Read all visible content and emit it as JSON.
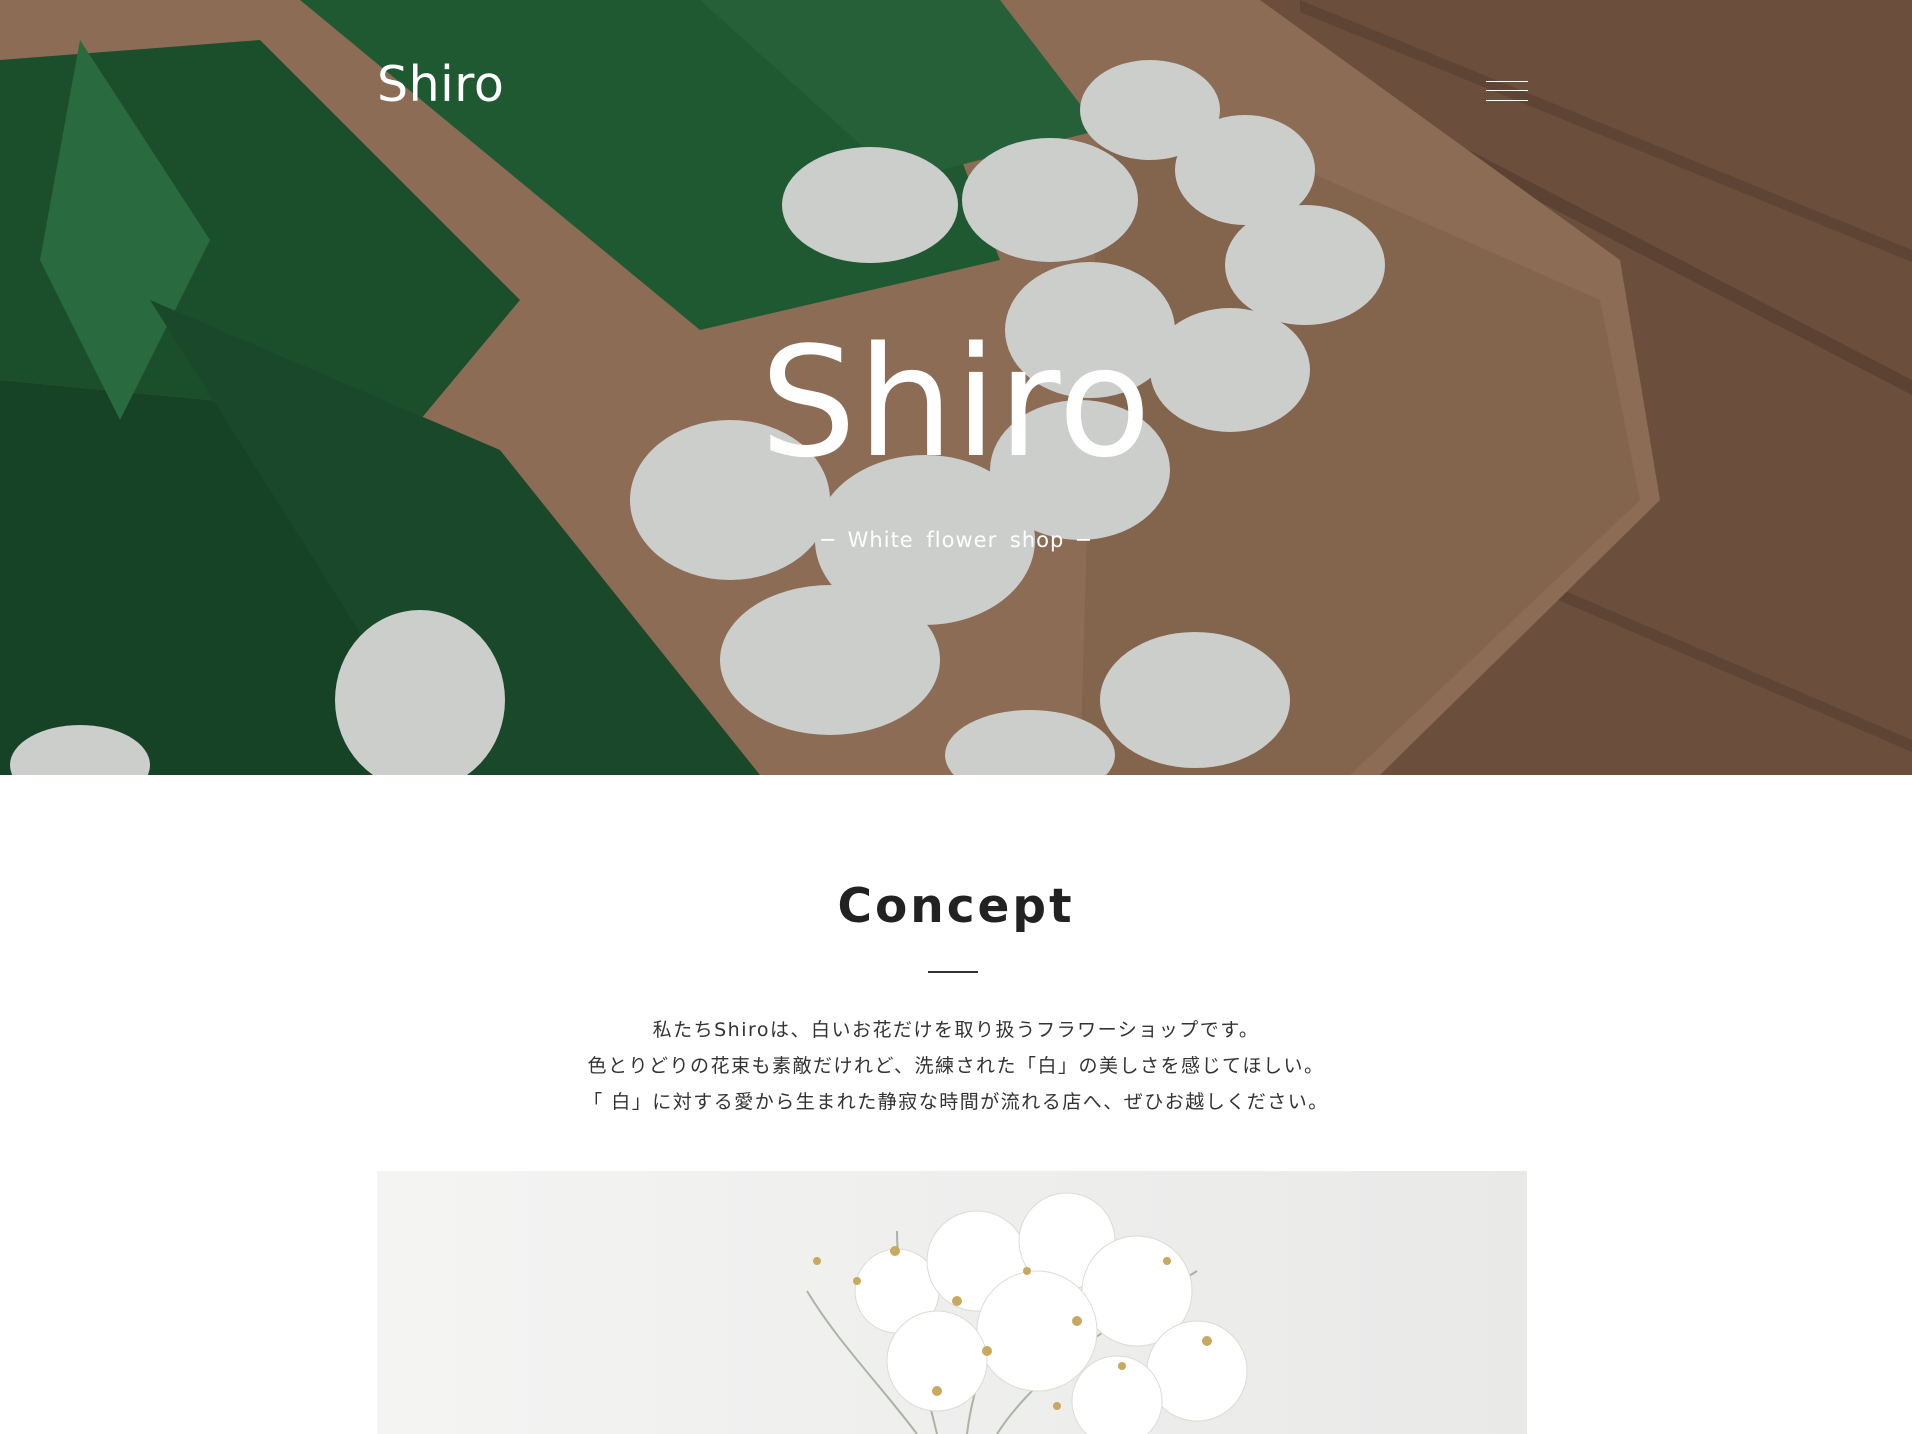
{
  "header": {
    "logo": "Shiro",
    "menu_icon": "hamburger-menu-icon"
  },
  "hero": {
    "title": "Shiro",
    "subtitle": "─ White flower shop ─",
    "image": "white-tulip-bouquet-image"
  },
  "concept": {
    "title": "Concept",
    "paragraphs": [
      "私たちShiroは、白いお花だけを取り扱うフラワーショップです。",
      "色とりどりの花束も素敵だけれど、洗練された「白」の美しさを感じてほしい。",
      "「 白」に対する愛から生まれた静寂な時間が流れる店へ、ぜひお越しください。"
    ],
    "image": "white-flower-arrangement-image"
  },
  "colors": {
    "accent_text": "#222222",
    "hero_text": "#ffffff",
    "background": "#ffffff"
  }
}
